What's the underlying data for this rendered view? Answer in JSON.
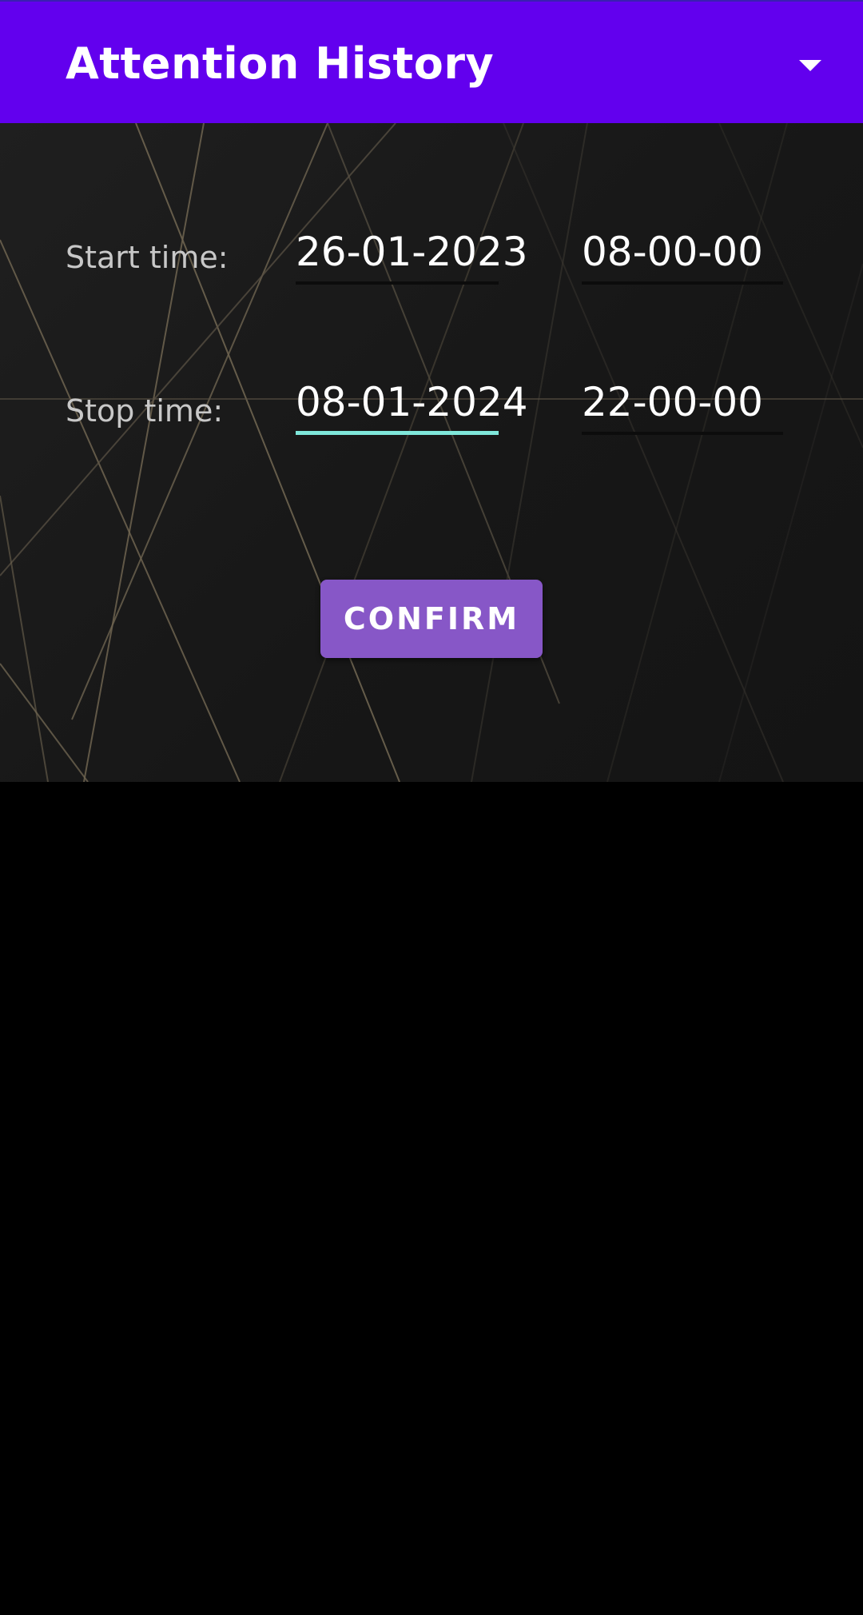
{
  "header": {
    "title": "Attention History",
    "menu_icon": "chevron-down-icon",
    "background_color": "#6200EE"
  },
  "form": {
    "start": {
      "label": "Start time:",
      "date": "26-01-2023",
      "time": "08-00-00"
    },
    "stop": {
      "label": "Stop time:",
      "date": "08-01-2024",
      "time": "22-00-00"
    },
    "active_field_color": "#7FE7DA"
  },
  "actions": {
    "confirm_label": "CONFIRM",
    "confirm_color": "#8757C7"
  }
}
